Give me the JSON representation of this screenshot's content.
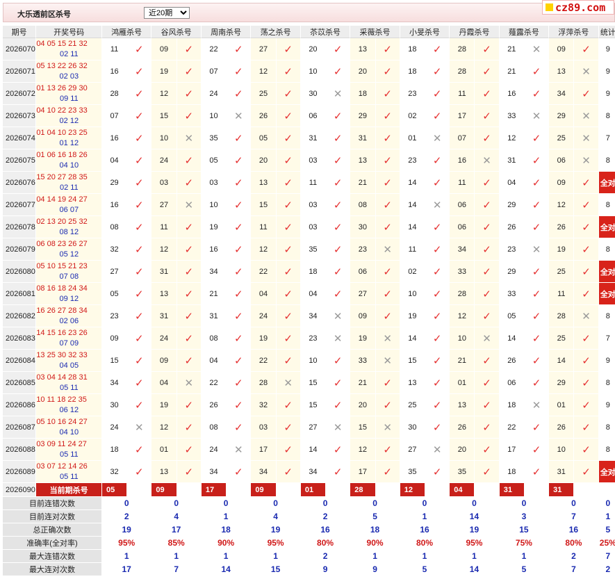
{
  "header": {
    "title": "大乐透前区杀号",
    "period_select": {
      "value": "近20期",
      "options": [
        "近20期"
      ]
    },
    "logo": "cz89.com"
  },
  "columns": {
    "issue": "期号",
    "draw": "开奖号码",
    "experts": [
      "鸿雁杀号",
      "谷风杀号",
      "周南杀号",
      "荡之杀号",
      "苶苡杀号",
      "采薇杀号",
      "小旻杀号",
      "丹霞杀号",
      "薤露杀号",
      "浮萍杀号"
    ],
    "stat": "统计"
  },
  "rows": [
    {
      "issue": "2026070",
      "front": "04 05 15 21 32",
      "back": "02 11",
      "picks": [
        "11",
        "09",
        "22",
        "27",
        "20",
        "13",
        "18",
        "28",
        "21",
        "09"
      ],
      "marks": "1111111101",
      "stat": "9"
    },
    {
      "issue": "2026071",
      "front": "05 13 22 26 32",
      "back": "02 03",
      "picks": [
        "16",
        "19",
        "07",
        "12",
        "10",
        "20",
        "18",
        "28",
        "21",
        "13"
      ],
      "marks": "1111111110",
      "stat": "9"
    },
    {
      "issue": "2026072",
      "front": "01 13 26 29 30",
      "back": "09 11",
      "picks": [
        "28",
        "12",
        "24",
        "25",
        "30",
        "18",
        "23",
        "11",
        "16",
        "34"
      ],
      "marks": "1111011111",
      "stat": "9"
    },
    {
      "issue": "2026073",
      "front": "04 10 22 23 33",
      "back": "02 12",
      "picks": [
        "07",
        "15",
        "10",
        "26",
        "06",
        "29",
        "02",
        "17",
        "33",
        "29"
      ],
      "marks": "1101111100",
      "stat": "8"
    },
    {
      "issue": "2026074",
      "front": "01 04 10 23 25",
      "back": "01 12",
      "picks": [
        "16",
        "10",
        "35",
        "05",
        "31",
        "31",
        "01",
        "07",
        "12",
        "25"
      ],
      "marks": "1011110110",
      "stat": "7"
    },
    {
      "issue": "2026075",
      "front": "01 06 16 18 26",
      "back": "04 10",
      "picks": [
        "04",
        "24",
        "05",
        "20",
        "03",
        "13",
        "23",
        "16",
        "31",
        "06"
      ],
      "marks": "1111111010",
      "stat": "8"
    },
    {
      "issue": "2026076",
      "front": "15 20 27 28 35",
      "back": "02 11",
      "picks": [
        "29",
        "03",
        "03",
        "13",
        "11",
        "21",
        "14",
        "11",
        "04",
        "09"
      ],
      "marks": "1111111111",
      "stat": "全对"
    },
    {
      "issue": "2026077",
      "front": "04 14 19 24 27",
      "back": "06 07",
      "picks": [
        "16",
        "27",
        "10",
        "15",
        "03",
        "08",
        "14",
        "06",
        "29",
        "12"
      ],
      "marks": "1011110111",
      "stat": "8"
    },
    {
      "issue": "2026078",
      "front": "02 13 20 25 32",
      "back": "08 12",
      "picks": [
        "08",
        "11",
        "19",
        "11",
        "03",
        "30",
        "14",
        "06",
        "26",
        "26"
      ],
      "marks": "1111111111",
      "stat": "全对"
    },
    {
      "issue": "2026079",
      "front": "06 08 23 26 27",
      "back": "05 12",
      "picks": [
        "32",
        "12",
        "16",
        "12",
        "35",
        "23",
        "11",
        "34",
        "23",
        "19"
      ],
      "marks": "1111101101",
      "stat": "8"
    },
    {
      "issue": "2026080",
      "front": "05 10 15 21 23",
      "back": "07 08",
      "picks": [
        "27",
        "31",
        "34",
        "22",
        "18",
        "06",
        "02",
        "33",
        "29",
        "25"
      ],
      "marks": "1111111111",
      "stat": "全对"
    },
    {
      "issue": "2026081",
      "front": "08 16 18 24 34",
      "back": "09 12",
      "picks": [
        "05",
        "13",
        "21",
        "04",
        "04",
        "27",
        "10",
        "28",
        "33",
        "11"
      ],
      "marks": "1111111111",
      "stat": "全对"
    },
    {
      "issue": "2026082",
      "front": "16 26 27 28 34",
      "back": "02 06",
      "picks": [
        "23",
        "31",
        "31",
        "24",
        "34",
        "09",
        "19",
        "12",
        "05",
        "28"
      ],
      "marks": "1111011110",
      "stat": "8"
    },
    {
      "issue": "2026083",
      "front": "14 15 16 23 26",
      "back": "07 09",
      "picks": [
        "09",
        "24",
        "08",
        "19",
        "23",
        "19",
        "14",
        "10",
        "14",
        "25"
      ],
      "marks": "1111001011",
      "stat": "7"
    },
    {
      "issue": "2026084",
      "front": "13 25 30 32 33",
      "back": "04 05",
      "picks": [
        "15",
        "09",
        "04",
        "22",
        "10",
        "33",
        "15",
        "21",
        "26",
        "14"
      ],
      "marks": "1111101111",
      "stat": "9"
    },
    {
      "issue": "2026085",
      "front": "03 04 14 28 31",
      "back": "05 11",
      "picks": [
        "34",
        "04",
        "22",
        "28",
        "15",
        "21",
        "13",
        "01",
        "06",
        "29"
      ],
      "marks": "1010111111",
      "stat": "8"
    },
    {
      "issue": "2026086",
      "front": "10 11 18 22 35",
      "back": "06 12",
      "picks": [
        "30",
        "19",
        "26",
        "32",
        "15",
        "20",
        "25",
        "13",
        "18",
        "01"
      ],
      "marks": "1111111101",
      "stat": "9"
    },
    {
      "issue": "2026087",
      "front": "05 10 16 24 27",
      "back": "04 10",
      "picks": [
        "24",
        "12",
        "08",
        "03",
        "27",
        "15",
        "30",
        "26",
        "22",
        "26"
      ],
      "marks": "0111001111",
      "stat": "8"
    },
    {
      "issue": "2026088",
      "front": "03 09 11 24 27",
      "back": "05 11",
      "picks": [
        "18",
        "01",
        "24",
        "17",
        "14",
        "12",
        "27",
        "20",
        "17",
        "10"
      ],
      "marks": "1101110111",
      "stat": "8"
    },
    {
      "issue": "2026089",
      "front": "03 07 12 14 26",
      "back": "05 11",
      "picks": [
        "32",
        "13",
        "34",
        "34",
        "34",
        "17",
        "35",
        "35",
        "18",
        "31"
      ],
      "marks": "1111111111",
      "stat": "全对"
    }
  ],
  "current": {
    "issue": "2026090",
    "label": "当前期杀号",
    "picks": [
      "05",
      "09",
      "17",
      "09",
      "01",
      "28",
      "12",
      "04",
      "31",
      "31"
    ]
  },
  "summary": [
    {
      "label": "目前连错次数",
      "values": [
        "0",
        "0",
        "0",
        "0",
        "0",
        "0",
        "0",
        "0",
        "0",
        "0"
      ],
      "stat": "0"
    },
    {
      "label": "目前连对次数",
      "values": [
        "2",
        "4",
        "1",
        "4",
        "2",
        "5",
        "1",
        "14",
        "3",
        "7"
      ],
      "stat": "1"
    },
    {
      "label": "总正确次数",
      "values": [
        "19",
        "17",
        "18",
        "19",
        "16",
        "18",
        "16",
        "19",
        "15",
        "16"
      ],
      "stat": "5"
    },
    {
      "label": "准确率(全对率)",
      "values": [
        "95%",
        "85%",
        "90%",
        "95%",
        "80%",
        "90%",
        "80%",
        "95%",
        "75%",
        "80%"
      ],
      "stat": "25%",
      "pct": true
    },
    {
      "label": "最大连错次数",
      "values": [
        "1",
        "1",
        "1",
        "1",
        "2",
        "1",
        "1",
        "1",
        "1",
        "2"
      ],
      "stat": "7"
    },
    {
      "label": "最大连对次数",
      "values": [
        "17",
        "7",
        "14",
        "15",
        "9",
        "9",
        "5",
        "14",
        "5",
        "7"
      ],
      "stat": "2"
    }
  ],
  "icons": {
    "correct": "check-mark-icon",
    "wrong": "cross-mark-icon"
  },
  "colors": {
    "front_ball": "#d01818",
    "back_ball": "#1a2ab0",
    "correct": "#e53030",
    "highlight": "#c8201a"
  }
}
